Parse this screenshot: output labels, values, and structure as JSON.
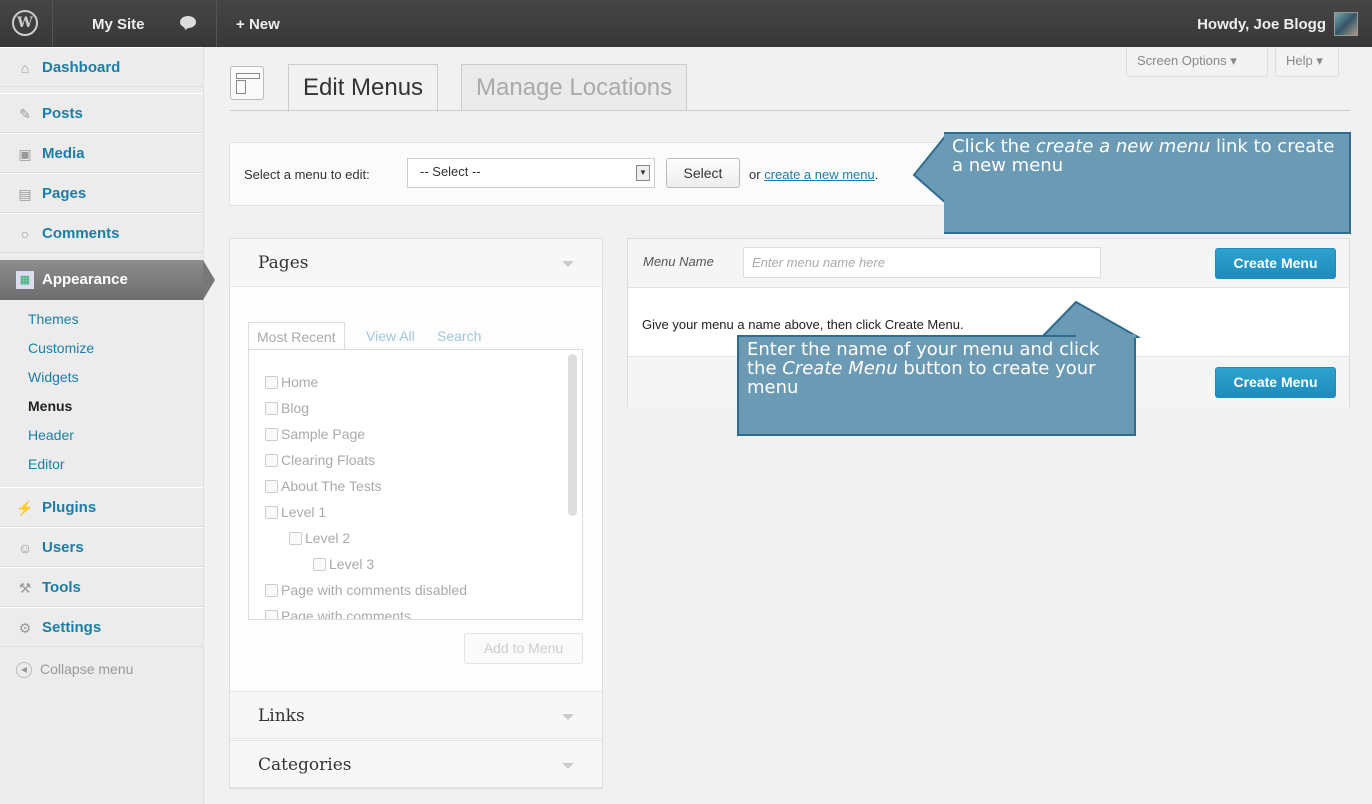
{
  "adminbar": {
    "site_name": "My Site",
    "new_label": "New",
    "greeting": "Howdy, Joe Blogg"
  },
  "sidebar": {
    "items": [
      {
        "label": "Dashboard",
        "icon": "dashboard-icon"
      },
      {
        "label": "Posts",
        "icon": "pin-icon"
      },
      {
        "label": "Media",
        "icon": "media-icon"
      },
      {
        "label": "Pages",
        "icon": "pages-icon"
      },
      {
        "label": "Comments",
        "icon": "comment-icon"
      },
      {
        "label": "Appearance",
        "icon": "appearance-icon"
      },
      {
        "label": "Plugins",
        "icon": "plug-icon"
      },
      {
        "label": "Users",
        "icon": "users-icon"
      },
      {
        "label": "Tools",
        "icon": "tools-icon"
      },
      {
        "label": "Settings",
        "icon": "settings-icon"
      }
    ],
    "submenu": [
      "Themes",
      "Customize",
      "Widgets",
      "Menus",
      "Header",
      "Editor"
    ],
    "collapse": "Collapse menu"
  },
  "screen_options": "Screen Options ▾",
  "help": "Help ▾",
  "tabs": {
    "edit": "Edit Menus",
    "manage": "Manage Locations"
  },
  "select_bar": {
    "label": "Select a menu to edit:",
    "selected": "-- Select --",
    "button": "Select",
    "or": "or",
    "link": "create a new menu",
    "period": "."
  },
  "pages_box": {
    "title": "Pages",
    "tabs": [
      "Most Recent",
      "View All",
      "Search"
    ],
    "items": [
      "Home",
      "Blog",
      "Sample Page",
      "Clearing Floats",
      "About The Tests",
      "Level 1",
      "Level 2",
      "Level 3",
      "Page with comments disabled",
      "Page with comments"
    ],
    "add_button": "Add to Menu"
  },
  "links_box": {
    "title": "Links"
  },
  "categories_box": {
    "title": "Categories"
  },
  "menu_edit": {
    "name_label": "Menu Name",
    "name_placeholder": "Enter menu name here",
    "create_button": "Create Menu",
    "instruction": "Give your menu a name above, then click Create Menu."
  },
  "callouts": {
    "top": {
      "pre": "Click the ",
      "em": "create a new menu",
      "post": " link to create a new menu"
    },
    "bottom": {
      "pre": "Enter the name of your menu and click the ",
      "em": "Create Menu",
      "post": " button to create your menu"
    }
  },
  "colors": {
    "accent": "#1a7fa8",
    "primary_button": "#2ea2cc",
    "callout": "#6b9ab5"
  }
}
